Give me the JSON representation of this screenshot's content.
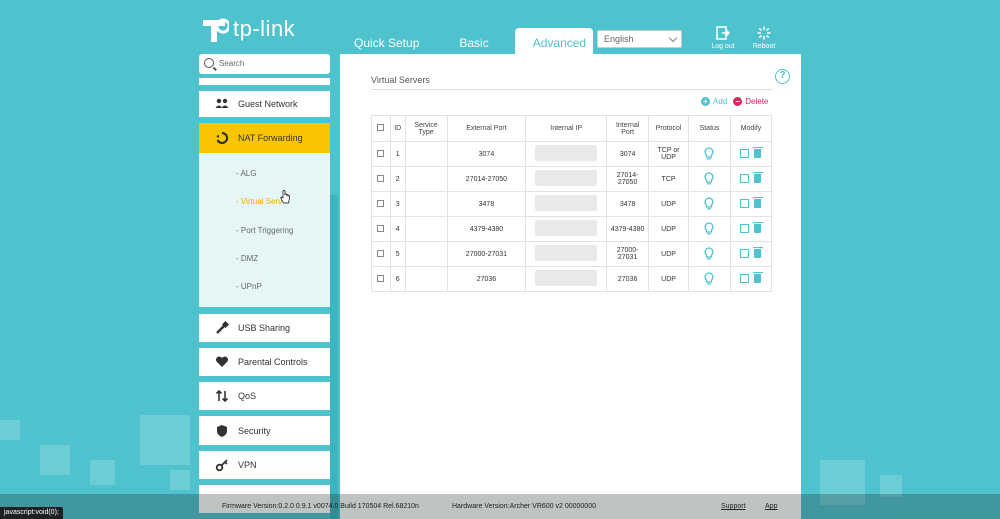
{
  "brand": {
    "name": "tp-link",
    "accent": "#4ec3cd",
    "highlight": "#f9c500"
  },
  "header": {
    "tabs": [
      {
        "label": "Quick Setup",
        "active": false
      },
      {
        "label": "Basic",
        "active": false
      },
      {
        "label": "Advanced",
        "active": true
      }
    ],
    "language": "English",
    "logout_label": "Log out",
    "reboot_label": "Reboot"
  },
  "sidebar": {
    "search_placeholder": "Search",
    "items": [
      {
        "label": "Guest Network",
        "icon": "guest-network-icon"
      },
      {
        "label": "NAT Forwarding",
        "icon": "nat-forwarding-icon",
        "active": true
      },
      {
        "label": "USB Sharing",
        "icon": "usb-icon"
      },
      {
        "label": "Parental Controls",
        "icon": "heart-icon"
      },
      {
        "label": "QoS",
        "icon": "qos-arrows-icon"
      },
      {
        "label": "Security",
        "icon": "shield-icon"
      },
      {
        "label": "VPN",
        "icon": "vpn-key-icon"
      }
    ],
    "submenu": [
      {
        "label": "- ALG"
      },
      {
        "label": "- Virtual Serv",
        "active": true
      },
      {
        "label": "- Port Triggering"
      },
      {
        "label": "- DMZ"
      },
      {
        "label": "- UPnP"
      }
    ]
  },
  "main": {
    "title": "Virtual Servers",
    "add_label": "Add",
    "delete_label": "Delete",
    "columns": [
      "",
      "ID",
      "Service Type",
      "External Port",
      "Internal IP",
      "Internal Port",
      "Protocol",
      "Status",
      "Modify"
    ],
    "rows": [
      {
        "id": "1",
        "service_type": "",
        "external_port": "3074",
        "internal_port": "3074",
        "protocol": "TCP or UDP"
      },
      {
        "id": "2",
        "service_type": "",
        "external_port": "27014-27050",
        "internal_port": "27014-27050",
        "protocol": "TCP"
      },
      {
        "id": "3",
        "service_type": "",
        "external_port": "3478",
        "internal_port": "3478",
        "protocol": "UDP"
      },
      {
        "id": "4",
        "service_type": "",
        "external_port": "4379-4380",
        "internal_port": "4379-4380",
        "protocol": "UDP"
      },
      {
        "id": "5",
        "service_type": "",
        "external_port": "27000-27031",
        "internal_port": "27000-27031",
        "protocol": "UDP"
      },
      {
        "id": "6",
        "service_type": "",
        "external_port": "27036",
        "internal_port": "27036",
        "protocol": "UDP"
      }
    ]
  },
  "footer": {
    "firmware": "Firmware Version:0.2.0 0.9.1 v0074.0 Build 170504 Rel.68210n",
    "hardware": "Hardware Version:Archer VR600 v2 00000000",
    "support": "Support",
    "app": "App"
  },
  "browser_status": "javascript:void(0);"
}
